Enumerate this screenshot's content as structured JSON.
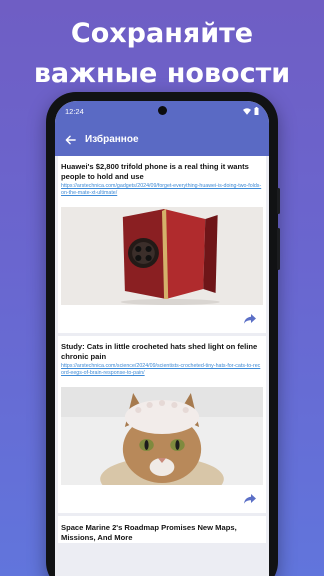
{
  "promo": {
    "headline_line1": "Сохраняйте",
    "headline_line2": "важные новости"
  },
  "status_bar": {
    "time": "12:24"
  },
  "app_bar": {
    "title": "Избранное",
    "back_icon": "arrow-left-icon"
  },
  "articles": [
    {
      "title": "Huawei's $2,800 trifold phone is a real thing it wants people to hold and use",
      "link": "https://arstechnica.com/gadgets/2024/09/forget-everything-huawei-is-doing-two-folds-on-the-mate-xt-ultimate/",
      "image": "red trifold phone photo",
      "share_icon": "share-icon"
    },
    {
      "title": "Study: Cats in little crocheted hats shed light on feline chronic pain",
      "link": "https://arstechnica.com/science/2024/09/scientists-crocheted-tiny-hats-for-cats-to-record-eegs-of-brain-response-to-pain/",
      "image": "cat wearing crocheted hat photo",
      "share_icon": "share-icon"
    },
    {
      "title": "Space Marine 2's Roadmap Promises New Maps, Missions, And More"
    }
  ],
  "colors": {
    "background_top": "#6f5ec4",
    "background_bottom": "#6175dc",
    "app_bar": "#5a6ac4",
    "link": "#3d8ad6",
    "share_icon": "#5b6fc6"
  }
}
